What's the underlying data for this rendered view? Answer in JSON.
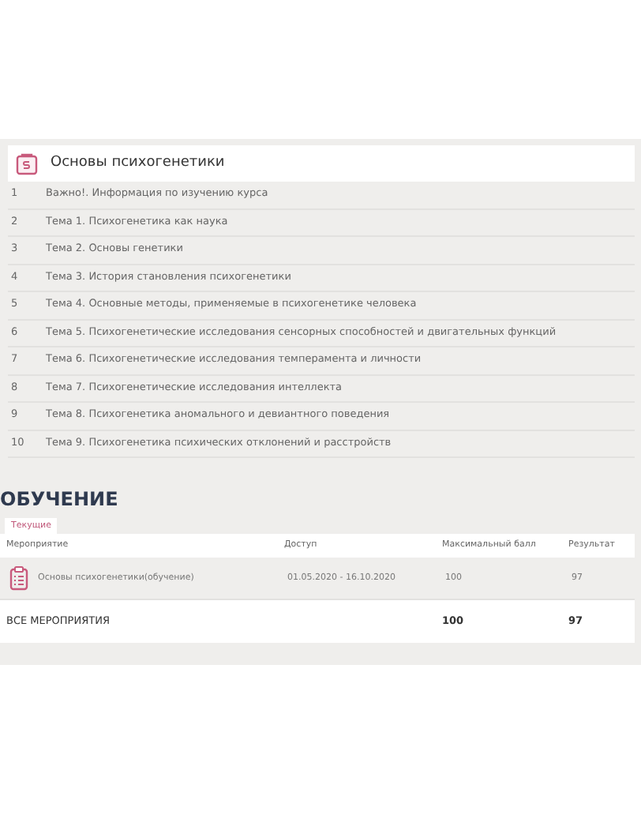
{
  "course": {
    "title": "Основы психогенетики",
    "topics": [
      {
        "number": "1",
        "title": "Важно!. Информация по изучению курса"
      },
      {
        "number": "2",
        "title": "Тема 1. Психогенетика как наука"
      },
      {
        "number": "3",
        "title": "Тема 2. Основы генетики"
      },
      {
        "number": "4",
        "title": "Тема 3. История становления психогенетики"
      },
      {
        "number": "5",
        "title": "Тема 4. Основные методы, применяемые в психогенетике человека"
      },
      {
        "number": "6",
        "title": "Тема 5. Психогенетические исследования сенсорных способностей и двигательных функций"
      },
      {
        "number": "7",
        "title": "Тема 6. Психогенетические исследования темперамента и личности"
      },
      {
        "number": "8",
        "title": "Тема 7. Психогенетические исследования интеллекта"
      },
      {
        "number": "9",
        "title": "Тема 8. Психогенетика аномального и девиантного поведения"
      },
      {
        "number": "10",
        "title": "Тема 9. Психогенетика психических отклонений и расстройств"
      }
    ]
  },
  "training": {
    "heading": "ОБУЧЕНИЕ",
    "tabs": [
      {
        "label": "Текущие",
        "selected": true
      }
    ],
    "columns": [
      "Мероприятие",
      "Доступ",
      "Максимальный балл",
      "Результат"
    ],
    "rows": [
      {
        "name": "Основы психогенетики(обучение)",
        "access": "01.05.2020 - 16.10.2020",
        "max_score": "100",
        "result": "97"
      }
    ],
    "total": {
      "label": "ВСЕ МЕРОПРИЯТИЯ",
      "max_score": "100",
      "result": "97"
    }
  }
}
